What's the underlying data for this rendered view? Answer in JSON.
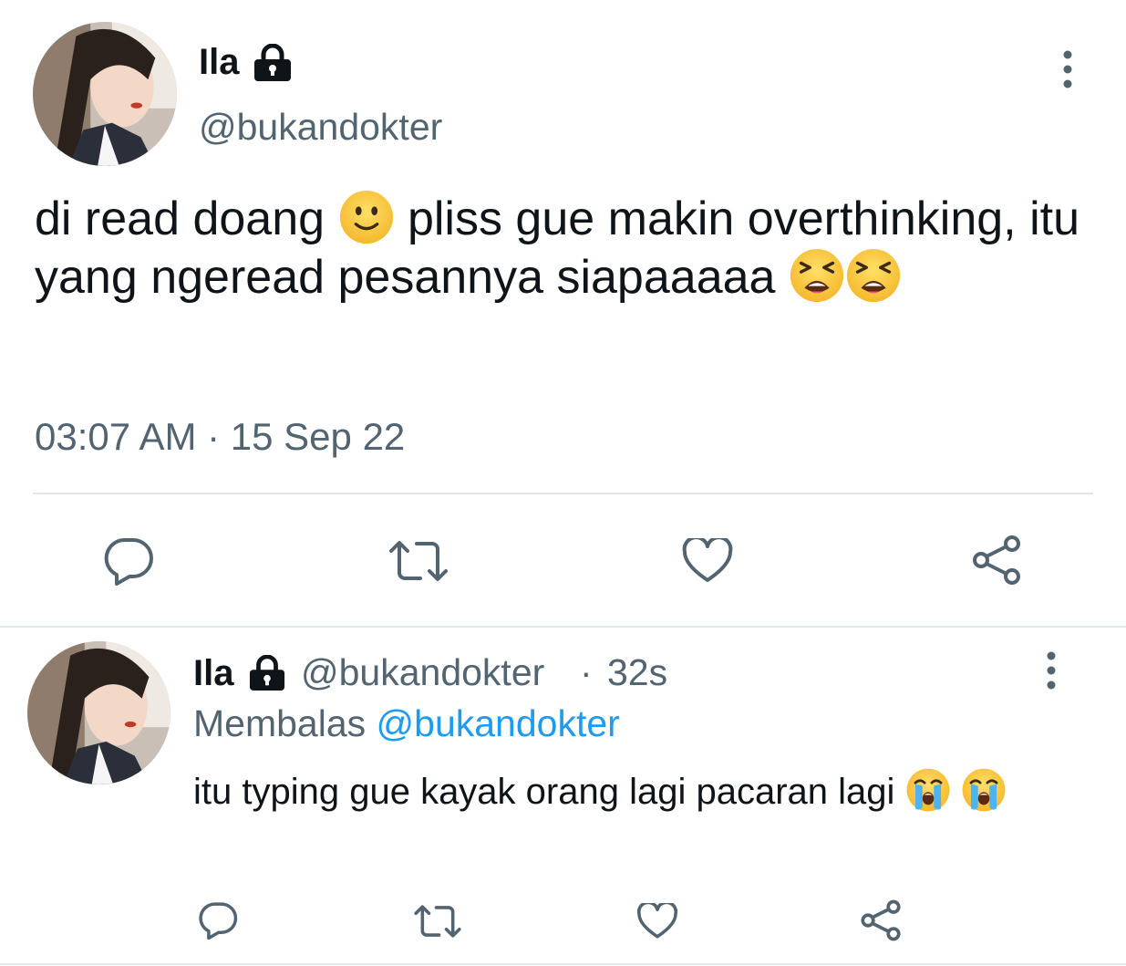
{
  "main_tweet": {
    "display_name": "Ila",
    "handle": "@bukandokter",
    "text_part1": "di read doang",
    "text_part2": "pliss gue makin overthinking, itu yang ngeread pesannya siapaaaaa",
    "emoji_after_part1": "slightly-smiling-face",
    "emojis_end": [
      "tired-face",
      "tired-face"
    ],
    "timestamp": "03:07 AM · 15 Sep 22"
  },
  "reply_tweet": {
    "display_name": "Ila",
    "handle": "@bukandokter",
    "separator": "·",
    "time": "32s",
    "replying_prefix": "Membalas",
    "replying_to": "@bukandokter",
    "text": "itu typing gue kayak orang lagi pacaran lagi",
    "emojis_end": [
      "loudly-crying-face",
      "loudly-crying-face"
    ]
  },
  "actions": [
    "reply-icon",
    "retweet-icon",
    "like-icon",
    "share-icon"
  ],
  "colors": {
    "text_primary": "#0f1419",
    "text_secondary": "#536471",
    "link": "#1d9bf0",
    "icon": "#536471",
    "divider": "#e1e6ea"
  }
}
